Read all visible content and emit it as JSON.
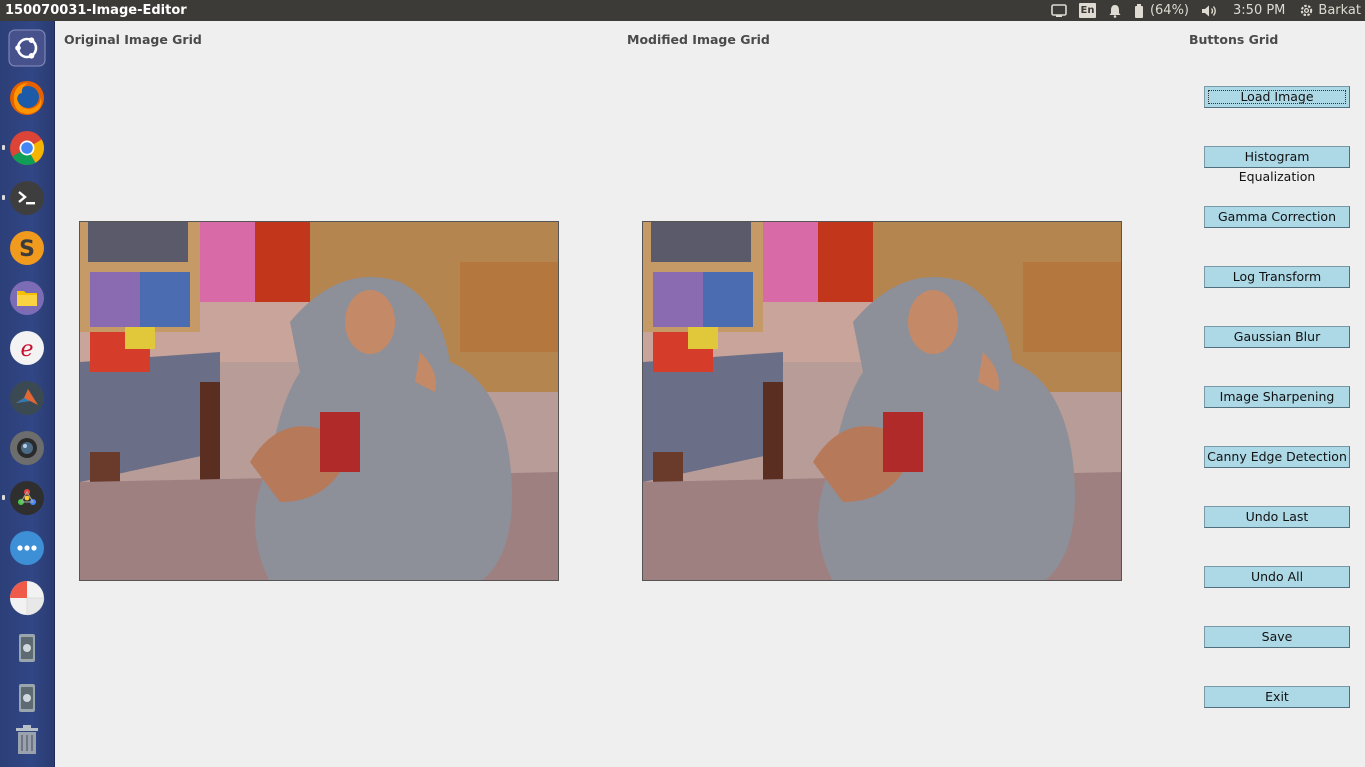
{
  "window": {
    "title": "150070031-Image-Editor"
  },
  "tray": {
    "language": "En",
    "battery_percent": "(64%)",
    "time": "3:50 PM",
    "user": "Barkat"
  },
  "launcher": {
    "items": [
      "ubuntu-dash",
      "firefox",
      "chrome",
      "terminal",
      "sublime-text",
      "files",
      "libreoffice-ext",
      "matlab",
      "camera",
      "settings-app",
      "more-apps",
      "disk-usage",
      "usb-drive",
      "usb-drive-2",
      "trash"
    ]
  },
  "sections": {
    "original": "Original Image Grid",
    "modified": "Modified Image Grid",
    "buttons": "Buttons Grid"
  },
  "buttons": {
    "load": "Load Image",
    "histogram": "Histogram Equalization",
    "gamma": "Gamma Correction",
    "log": "Log Transform",
    "blur": "Gaussian Blur",
    "sharpen": "Image Sharpening",
    "canny": "Canny Edge Detection",
    "undo_last": "Undo Last",
    "undo_all": "Undo All",
    "save": "Save",
    "exit": "Exit"
  },
  "colors": {
    "button_bg": "#add8e6",
    "panel_bg": "#efefef",
    "topbar_bg": "#3c3b37",
    "launcher_bg": "#314685"
  }
}
